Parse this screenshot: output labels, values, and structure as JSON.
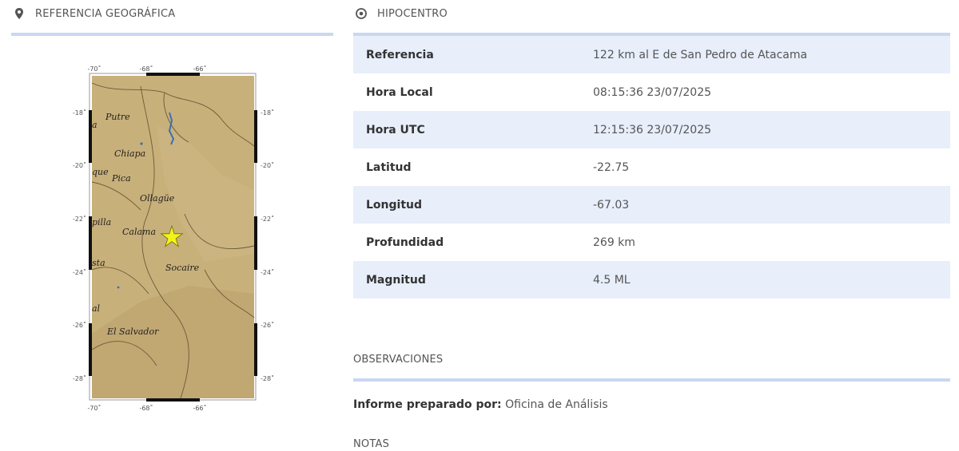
{
  "geo": {
    "title": "REFERENCIA GEOGRÁFICA"
  },
  "hipocentro": {
    "title": "HIPOCENTRO",
    "rows": [
      {
        "label": "Referencia",
        "value": "122 km al E de San Pedro de Atacama"
      },
      {
        "label": "Hora Local",
        "value": "08:15:36 23/07/2025"
      },
      {
        "label": "Hora UTC",
        "value": "12:15:36 23/07/2025"
      },
      {
        "label": "Latitud",
        "value": "-22.75"
      },
      {
        "label": "Longitud",
        "value": "-67.03"
      },
      {
        "label": "Profundidad",
        "value": "269 km"
      },
      {
        "label": "Magnitud",
        "value": "4.5 ML"
      }
    ]
  },
  "map": {
    "lon_ticks": [
      "-70˚",
      "-68˚",
      "-66˚"
    ],
    "lat_ticks": [
      "-18˚",
      "-20˚",
      "-22˚",
      "-24˚",
      "-26˚",
      "-28˚"
    ],
    "places": [
      "Putre",
      "a",
      "Chiapa",
      "que",
      "Pica",
      "Ollagüe",
      "pilla",
      "Calama",
      "sta",
      "Socaire",
      "al",
      "El Salvador"
    ]
  },
  "observaciones": {
    "title": "OBSERVACIONES",
    "informe_label": "Informe preparado por:",
    "informe_value": "Oficina de Análisis"
  },
  "notas": {
    "title": "NOTAS"
  },
  "colors": {
    "accent_underline": "#c9d8f1",
    "row_stripe": "#e8eefa",
    "map_land": "#c8b07a"
  }
}
